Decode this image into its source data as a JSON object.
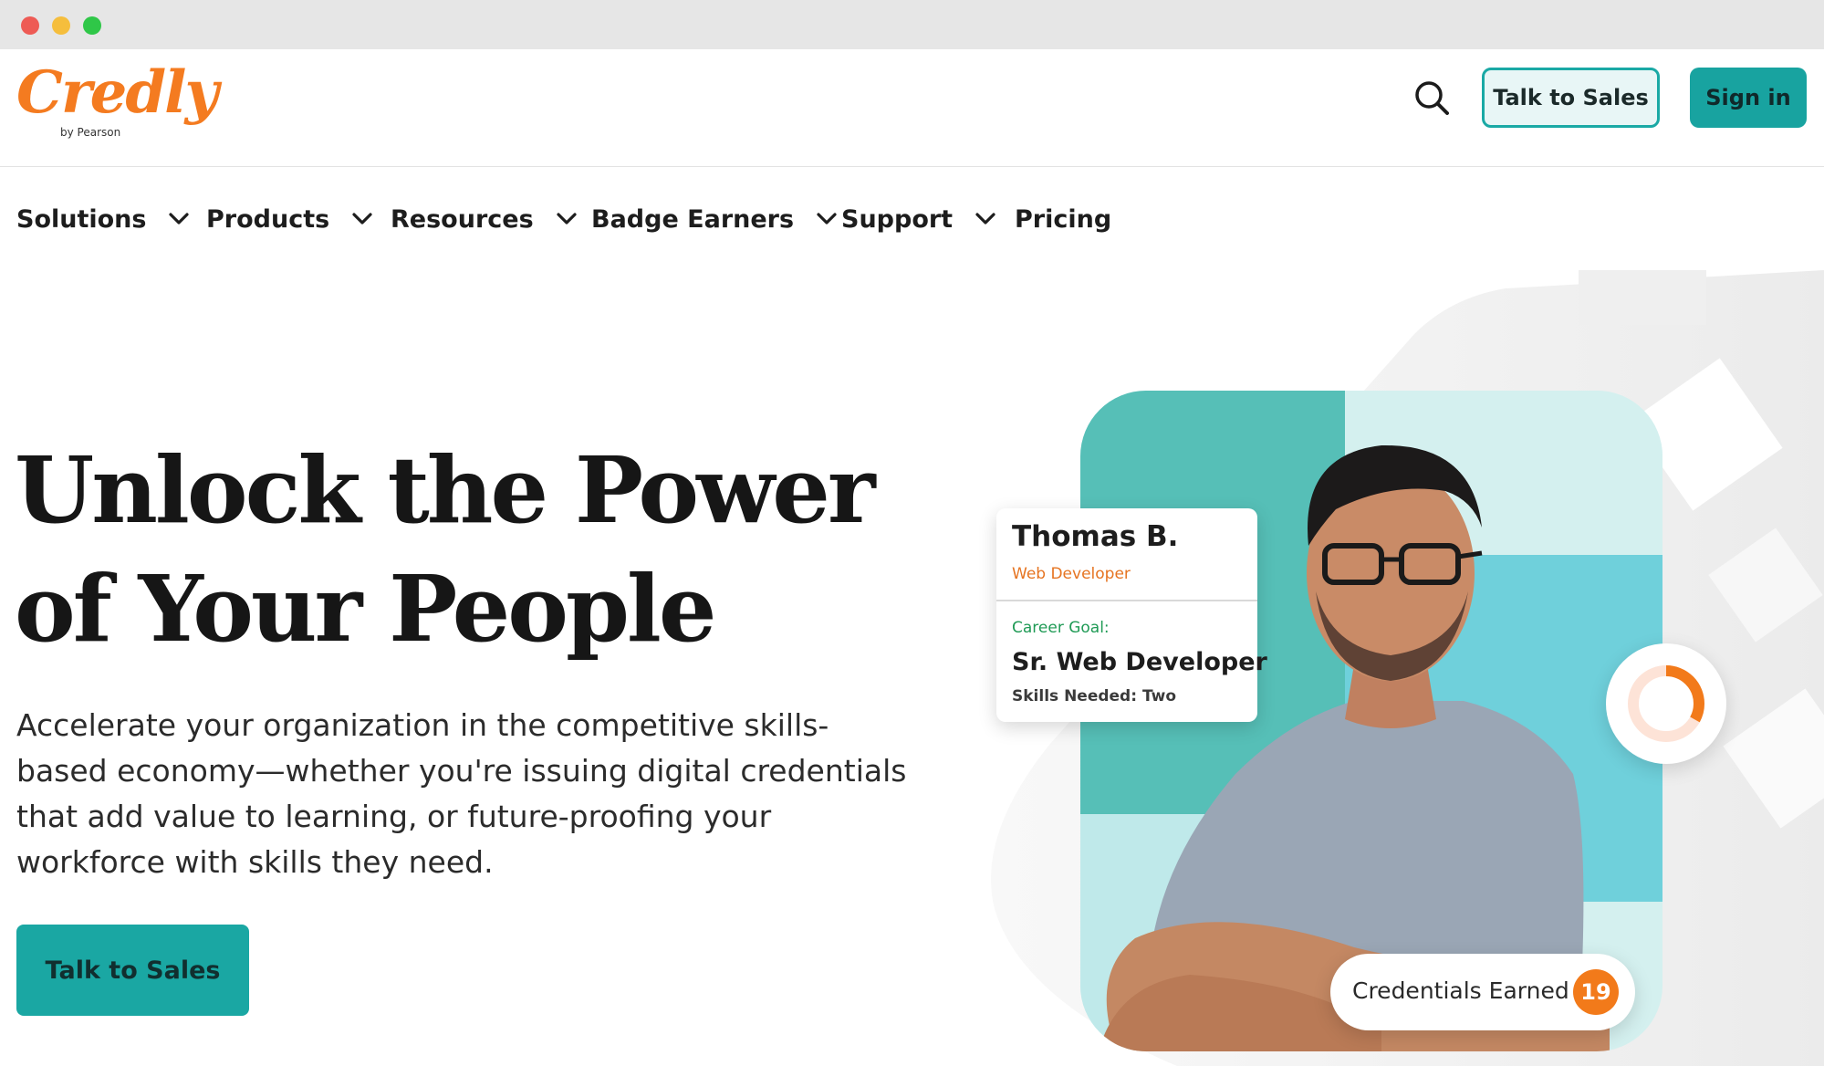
{
  "window": {
    "controls": [
      "close",
      "minimize",
      "maximize"
    ]
  },
  "header": {
    "logo_text": "Credly",
    "logo_sub": "by Pearson",
    "search_icon": "search-icon",
    "talk_to_sales": "Talk to Sales",
    "sign_in": "Sign in"
  },
  "nav": {
    "items": [
      {
        "label": "Solutions",
        "has_dropdown": true
      },
      {
        "label": "Products",
        "has_dropdown": true
      },
      {
        "label": "Resources",
        "has_dropdown": true
      },
      {
        "label": "Badge Earners",
        "has_dropdown": true
      },
      {
        "label": "Support",
        "has_dropdown": true
      },
      {
        "label": "Pricing",
        "has_dropdown": false
      }
    ]
  },
  "hero": {
    "title_line1": "Unlock the Power",
    "title_line2": "of Your People",
    "body": "Accelerate your organization in the competitive skills-based economy—whether you're issuing digital credentials that add value to learning, or future-proofing your workforce with skills they need.",
    "cta": "Talk to Sales"
  },
  "profile_card": {
    "name": "Thomas B.",
    "role": "Web Developer",
    "goal_label": "Career Goal:",
    "goal": "Sr. Web Developer",
    "skills_needed": "Skills Needed: Two"
  },
  "progress_ring": {
    "progress": 0.33
  },
  "credentials": {
    "label": "Credentials Earned",
    "count": "19"
  },
  "colors": {
    "brand_orange": "#f47b20",
    "brand_teal": "#18a3a0",
    "panel_teal_dark": "#56bfb7",
    "panel_teal_light": "#d4f0ef",
    "panel_cyan": "#6fd0db"
  }
}
